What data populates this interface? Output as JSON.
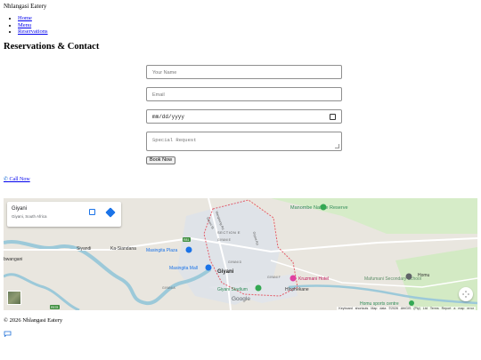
{
  "site": {
    "title": "Nhlangasi Eatery"
  },
  "nav": {
    "items": [
      "Home",
      "Menu",
      "Reservations"
    ]
  },
  "page": {
    "heading": "Reservations & Contact"
  },
  "form": {
    "name_placeholder": "Your Name",
    "email_placeholder": "Email",
    "date_placeholder": "mm/dd/yyyy",
    "request_placeholder": "Special Request",
    "submit_label": "Book Now"
  },
  "contact": {
    "call_label": "Call Now",
    "call_icon": "phone-icon"
  },
  "map": {
    "place_name": "Giyani",
    "place_sub": "Giyani, South Africa",
    "labels": {
      "reserve": "Manombe Nature Reserve",
      "siyandi": "Siyandi",
      "kasiandana": "Ka-Siandana",
      "mapingela": "Masingita Plaza",
      "mall": "Masingita Mall",
      "giyani": "Giyani",
      "stadium": "Giyani Stadium",
      "hotel": "Kruzmani Hotel",
      "hlophekane": "Hlophekane",
      "secondary": "Mafumani Secondary School",
      "homu": "Homu",
      "sports": "Homu sports centre",
      "bwangani": "bwangani",
      "section_e": "SECTION E",
      "giyani_e": "GIYANI E",
      "giyani_d": "GIYANI D",
      "giyani_f": "GIYANI F",
      "giyani_a": "GIYANI A",
      "street_1": "Giyani St",
      "street_2": "Mangaung Rd",
      "street_3": "Giyani Rd",
      "route_1": "R81",
      "route_2": "R578"
    },
    "logo": "Google",
    "attribution": "Keyboard shortcuts   Map data ©2026 AfriGIS (Pty) Ltd   Terms   Report a map error",
    "colors": {
      "water": "#7fbfd6",
      "park": "#bfe0b0",
      "urban": "#dfe3e8",
      "boundary": "#e35d6a"
    }
  },
  "footer": {
    "copyright": "© 2026 Nhlangasi Eatery",
    "chat_icon": "chat-icon"
  }
}
